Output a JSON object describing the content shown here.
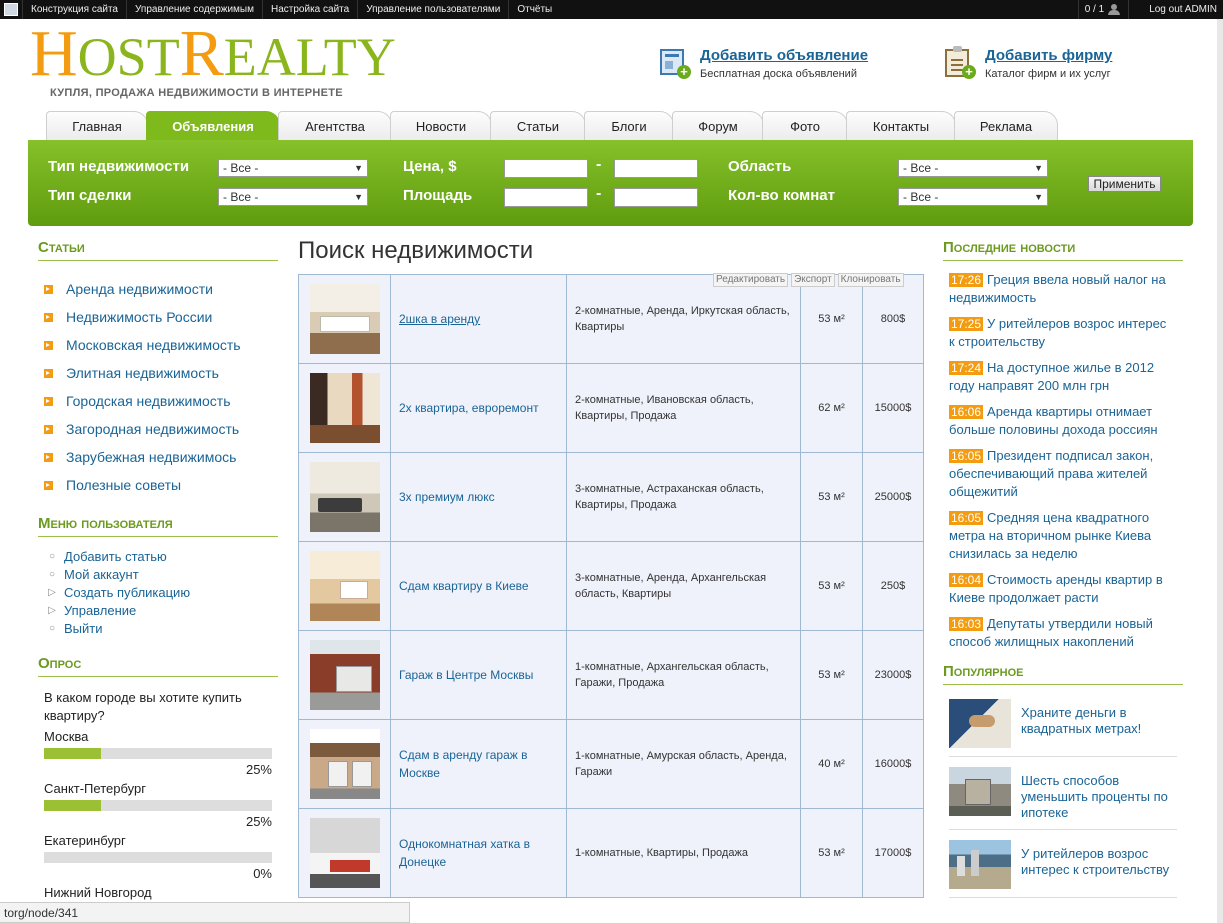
{
  "adminbar": {
    "items": [
      "Конструкция сайта",
      "Управление содержимым",
      "Настройка сайта",
      "Управление пользователями",
      "Отчёты"
    ],
    "counter": "0 / 1",
    "logout": "Log out ADMIN"
  },
  "header": {
    "logo_h": "H",
    "logo_ost": "OST",
    "logo_r": "R",
    "logo_ealty": "EALTY",
    "tagline": "КУПЛЯ, ПРОДАЖА НЕДВИЖИМОСТИ В ИНТЕРНЕТЕ",
    "promo1": {
      "title": "Добавить объявление",
      "sub": "Бесплатная доска объявлений"
    },
    "promo2": {
      "title": "Добавить фирму",
      "sub": "Каталог фирм и их услуг"
    }
  },
  "tabs": [
    {
      "label": "Главная"
    },
    {
      "label": "Объявления"
    },
    {
      "label": "Агентства"
    },
    {
      "label": "Новости"
    },
    {
      "label": "Статьи"
    },
    {
      "label": "Блоги"
    },
    {
      "label": "Форум"
    },
    {
      "label": "Фото"
    },
    {
      "label": "Контакты"
    },
    {
      "label": "Реклама"
    }
  ],
  "filter": {
    "type_label": "Тип недвижимости",
    "deal_label": "Тип сделки",
    "price_label": "Цена, $",
    "area_label": "Площадь",
    "region_label": "Область",
    "rooms_label": "Кол-во комнат",
    "select_value": "- Все -",
    "dash": "-",
    "apply": "Применить"
  },
  "left": {
    "articles_title": "Статьи",
    "categories": [
      "Аренда недвижимости",
      "Недвижимость России",
      "Московская недвижимость",
      "Элитная недвижимость",
      "Городская недвижимость",
      "Загородная недвижимость",
      "Зарубежная недвижимось",
      "Полезные советы"
    ],
    "menu_title": "Меню пользователя",
    "menu": [
      {
        "label": "Добавить статью",
        "bullet": "○"
      },
      {
        "label": "Мой аккаунт",
        "bullet": "○"
      },
      {
        "label": "Создать публикацию",
        "bullet": "▷"
      },
      {
        "label": "Управление",
        "bullet": "▷"
      },
      {
        "label": "Выйти",
        "bullet": "○"
      }
    ],
    "poll_title": "Опрос",
    "poll_question": "В каком городе вы хотите купить квартиру?",
    "poll": [
      {
        "city": "Москва",
        "pct": "25%"
      },
      {
        "city": "Санкт-Петербург",
        "pct": "25%"
      },
      {
        "city": "Екатеринбург",
        "pct": "0%"
      },
      {
        "city": "Нижний Новгород",
        "pct": ""
      }
    ]
  },
  "main": {
    "title": "Поиск недвижимости",
    "actions": [
      "Редактировать",
      "Экспорт",
      "Клонировать"
    ],
    "rows": [
      {
        "title": "2шка в аренду",
        "desc": "2-комнатные, Аренда, Иркутская область, Квартиры",
        "area": "53 м²",
        "price": "800$"
      },
      {
        "title": "2х квартира, евроремонт",
        "desc": "2-комнатные, Ивановская область, Квартиры, Продажа",
        "area": "62 м²",
        "price": "15000$"
      },
      {
        "title": "3х премиум люкс",
        "desc": "3-комнатные, Астраханская область, Квартиры, Продажа",
        "area": "53 м²",
        "price": "25000$"
      },
      {
        "title": "Сдам квартиру в Киеве",
        "desc": "3-комнатные, Аренда, Архангельская область, Квартиры",
        "area": "53 м²",
        "price": "250$"
      },
      {
        "title": "Гараж в Центре Москвы",
        "desc": "1-комнатные, Архангельская область, Гаражи, Продажа",
        "area": "53 м²",
        "price": "23000$"
      },
      {
        "title": "Сдам в аренду гараж в Москве",
        "desc": "1-комнатные, Амурская область, Аренда, Гаражи",
        "area": "40 м²",
        "price": "16000$"
      },
      {
        "title": "Однокомнатная хатка в Донецке",
        "desc": "1-комнатные, Квартиры, Продажа",
        "area": "53 м²",
        "price": "17000$"
      }
    ]
  },
  "right": {
    "news_title": "Последние новости",
    "news": [
      {
        "time": "17:26",
        "text": "Греция ввела новый налог на недвижимость"
      },
      {
        "time": "17:25",
        "text": "У ритейлеров возрос интерес к строительству"
      },
      {
        "time": "17:24",
        "text": "На доступное жилье в 2012 году направят 200 млн грн"
      },
      {
        "time": "16:06",
        "text": "Аренда квартиры отнимает больше половины дохода россиян"
      },
      {
        "time": "16:05",
        "text": "Президент подписал закон, обеспечивающий права жителей общежитий"
      },
      {
        "time": "16:05",
        "text": "Средняя цена квадратного метра на вторичном рынке Киева снизилась за неделю"
      },
      {
        "time": "16:04",
        "text": "Стоимость аренды квартир в Киеве продолжает расти"
      },
      {
        "time": "16:03",
        "text": "Депутаты утвердили новый способ жилищных накоплений"
      }
    ],
    "popular_title": "Популярное",
    "popular": [
      {
        "text": "Храните деньги в квадратных метрах!"
      },
      {
        "text": "Шесть способов уменьшить проценты по ипотеке"
      },
      {
        "text": "У ритейлеров возрос интерес к строительству"
      }
    ]
  },
  "status": "torg/node/341"
}
